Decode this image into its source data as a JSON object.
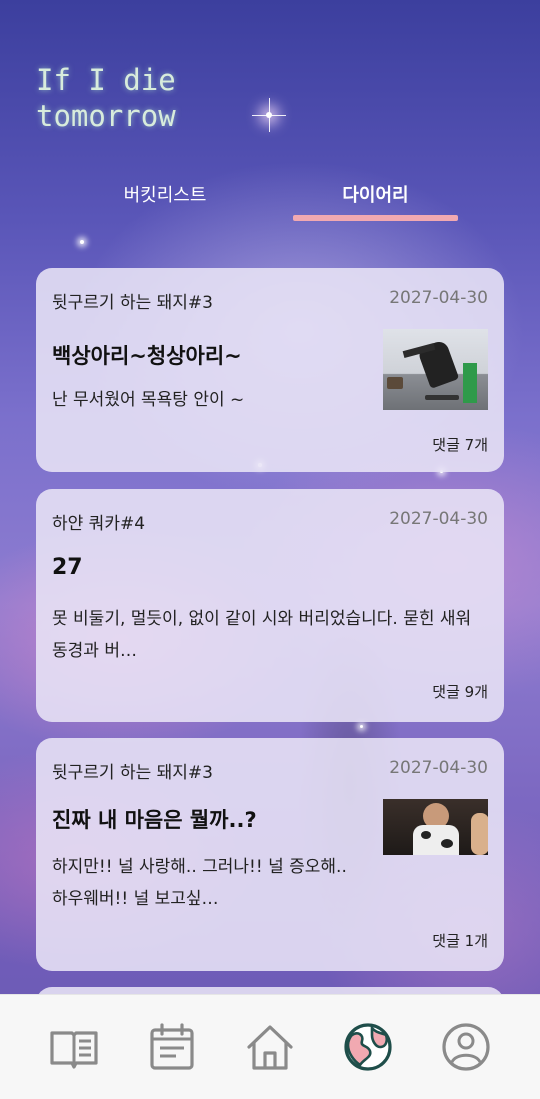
{
  "app": {
    "title": "If I die\ntomorrow"
  },
  "tabs": [
    {
      "label": "버킷리스트",
      "active": false
    },
    {
      "label": "다이어리",
      "active": true
    }
  ],
  "colors": {
    "tab_indicator": "#f1a9b1",
    "nav_icon": "#8a8a8a",
    "nav_active": "#1f4e4a",
    "nav_active_fill": "#f1a9b1"
  },
  "posts": [
    {
      "author": "뒷구르기 하는 돼지#3",
      "date": "2027-04-30",
      "title": "백상아리~청상아리~",
      "body": "난 무서웠어 목욕탕 안이 ~",
      "comments": "댓글 7개",
      "has_image": true
    },
    {
      "author": "하얀 쿼카#4",
      "date": "2027-04-30",
      "title": "27",
      "body": "못 비둘기, 멀듯이, 없이 같이 시와 버리었습니다. 묻힌 새워 동경과 버…",
      "comments": "댓글 9개",
      "has_image": false
    },
    {
      "author": "뒷구르기 하는 돼지#3",
      "date": "2027-04-30",
      "title": "진짜 내 마음은 뭘까..?",
      "body": "하지만!! 널 사랑해.. 그러나!! 널 증오해.. 하우웨버!! 널 보고싶…",
      "comments": "댓글 1개",
      "has_image": true
    }
  ],
  "bottom_nav": [
    {
      "icon": "book-icon",
      "active": false
    },
    {
      "icon": "calendar-icon",
      "active": false
    },
    {
      "icon": "home-icon",
      "active": false
    },
    {
      "icon": "globe-icon",
      "active": true
    },
    {
      "icon": "profile-icon",
      "active": false
    }
  ]
}
